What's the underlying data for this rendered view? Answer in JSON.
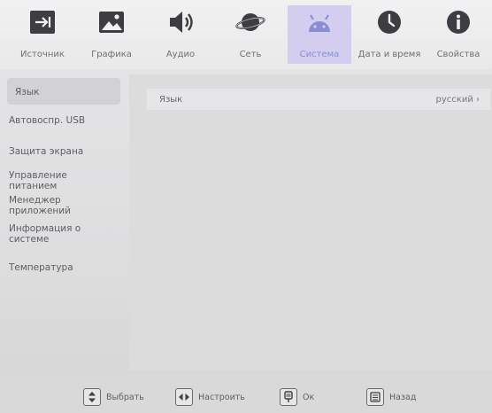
{
  "tabs": [
    {
      "label": "Источник",
      "icon": "input-source-icon"
    },
    {
      "label": "Графика",
      "icon": "image-icon"
    },
    {
      "label": "Аудио",
      "icon": "speaker-icon"
    },
    {
      "label": "Сеть",
      "icon": "globe-planet-icon"
    },
    {
      "label": "Система",
      "icon": "android-icon",
      "active": true
    },
    {
      "label": "Дата и время",
      "icon": "clock-icon"
    },
    {
      "label": "Свойства",
      "icon": "info-icon"
    }
  ],
  "sidebar": {
    "items": [
      {
        "label": "Язык",
        "selected": true
      },
      {
        "label": "Автовоспр. USB"
      },
      {
        "label": "Защита экрана"
      },
      {
        "label": "Управление питанием"
      },
      {
        "label": "Менеджер приложений"
      },
      {
        "label": "Информация о системе"
      },
      {
        "label": "Температура"
      }
    ]
  },
  "content": {
    "language_label": "Язык",
    "language_value": "русский ›"
  },
  "hints": [
    {
      "label": "Выбрать",
      "icon": "updown-arrows-icon"
    },
    {
      "label": "Настроить",
      "icon": "leftright-arrows-icon"
    },
    {
      "label": "Ок",
      "icon": "ok-button-icon"
    },
    {
      "label": "Назад",
      "icon": "back-menu-icon"
    }
  ],
  "colors": {
    "active_tab_bg": "#d3cdf0",
    "active_tab_text": "#8a8dd6",
    "icon_dark": "#3d3d42"
  }
}
